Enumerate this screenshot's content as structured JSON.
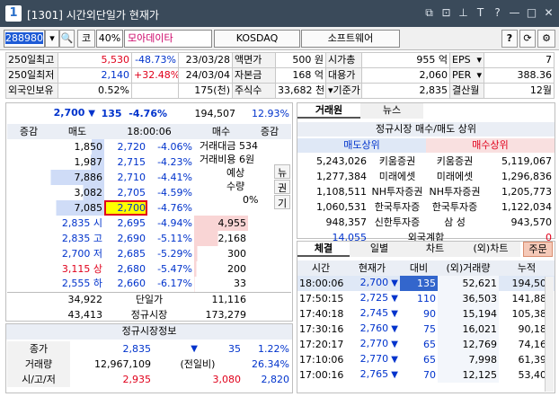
{
  "window": {
    "badge": "1",
    "code_label": "[1301]",
    "title": "시간외단일가 현재가",
    "icons": [
      "restore-icon",
      "copy-window-icon",
      "pin-icon",
      "font-size-icon",
      "help-icon",
      "minimize-icon",
      "maximize-icon",
      "close-icon"
    ]
  },
  "toolbar": {
    "stock_code": "288980",
    "code_btn": "코",
    "margin": "40%",
    "stock_name": "모아데이타",
    "market": "KOSDAQ",
    "sector": "소프트웨어",
    "help": "?",
    "refresh": "⟳",
    "settings": "⚙"
  },
  "info": [
    [
      "250일최고",
      "5,530",
      "-48.73%",
      "23/03/28",
      "액면가",
      "500 원",
      "시가총",
      "955 억",
      "EPS",
      "7"
    ],
    [
      "250일최저",
      "2,140",
      "+32.48%",
      "24/03/04",
      "자본금",
      "168 억",
      "대용가",
      "2,060",
      "PER",
      "388.36"
    ],
    [
      "외국인보유",
      "0.52%",
      "",
      "175(천)",
      "주식수",
      "33,682 천",
      "기준가",
      "2,835",
      "결산월",
      "12월"
    ]
  ],
  "quote": {
    "price": "2,700",
    "change": "135",
    "rate": "-4.76%",
    "volume": "194,507",
    "turn": "12.93%"
  },
  "ob_head": [
    "증감",
    "매도",
    "18:00:06",
    "매수",
    "증감"
  ],
  "asks": [
    [
      "",
      "1,850",
      "2,720",
      "-4.06%"
    ],
    [
      "",
      "1,987",
      "2,715",
      "-4.23%"
    ],
    [
      "",
      "7,886",
      "2,710",
      "-4.41%"
    ],
    [
      "",
      "3,082",
      "2,705",
      "-4.59%"
    ],
    [
      "",
      "7,085",
      "2,700",
      "-4.76%"
    ]
  ],
  "ask_bars": [
    0.23,
    0.25,
    0.99,
    0.39,
    0.89
  ],
  "ob_side": {
    "amt_label": "거래대금",
    "amt": "534",
    "vol_label": "거래비용",
    "vol": "6원",
    "exp_label": "예상",
    "qty_label": "수량",
    "pct": "0%",
    "btns": [
      "뉴",
      "권",
      "기"
    ]
  },
  "bids": [
    [
      "2,835",
      "시",
      "2,695",
      "-4.94%",
      "4,955"
    ],
    [
      "2,835",
      "고",
      "2,690",
      "-5.11%",
      "2,168"
    ],
    [
      "2,700",
      "저",
      "2,685",
      "-5.29%",
      "300"
    ],
    [
      "3,115",
      "상",
      "2,680",
      "-5.47%",
      "200"
    ],
    [
      "2,555",
      "하",
      "2,660",
      "-6.17%",
      "33"
    ]
  ],
  "bid_bars": [
    1.0,
    0.44,
    0.06,
    0.04,
    0.01
  ],
  "ob_foot": [
    [
      "34,922",
      "단일가",
      "11,116"
    ],
    [
      "43,413",
      "정규시장",
      "173,279"
    ],
    [
      "",
      "시간외",
      "34,871"
    ]
  ],
  "regular": {
    "title": "정규시장정보",
    "rows": [
      [
        "종가",
        "2,835",
        "▼",
        "35",
        "1.22%"
      ],
      [
        "거래량",
        "12,967,109",
        "(전일비)",
        "",
        "26.34%"
      ],
      [
        "시/고/저",
        "2,935",
        "3,080",
        "",
        "2,820"
      ]
    ]
  },
  "broker": {
    "tabs": [
      "거래원",
      "뉴스"
    ],
    "title": "정규시장 매수/매도 상위",
    "sell_head": "매도상위",
    "buy_head": "매수상위",
    "rows": [
      [
        "5,243,026",
        "키움증권",
        "키움증권",
        "5,119,067"
      ],
      [
        "1,277,384",
        "미래에셋",
        "미래에셋",
        "1,296,836"
      ],
      [
        "1,108,511",
        "NH투자증권",
        "NH투자증권",
        "1,205,773"
      ],
      [
        "1,060,531",
        "한국투자증",
        "한국투자증",
        "1,122,034"
      ],
      [
        "948,357",
        "신한투자증",
        "삼 성",
        "943,570"
      ]
    ],
    "foreign": [
      "14,055",
      "외국계합",
      "0"
    ]
  },
  "trade": {
    "tabs": [
      "체결",
      "일별",
      "차트",
      "(외)차트",
      "주문"
    ],
    "head": [
      "시간",
      "현재가",
      "대비",
      "(외)거래량",
      "누적"
    ],
    "rows": [
      [
        "18:00:06",
        "2,700",
        "135",
        "52,621",
        "194,507"
      ],
      [
        "17:50:15",
        "2,725",
        "110",
        "36,503",
        "141,886"
      ],
      [
        "17:40:18",
        "2,745",
        "90",
        "15,194",
        "105,383"
      ],
      [
        "17:30:16",
        "2,760",
        "75",
        "16,021",
        "90,189"
      ],
      [
        "17:20:17",
        "2,770",
        "65",
        "12,769",
        "74,168"
      ],
      [
        "17:10:06",
        "2,770",
        "65",
        "7,998",
        "61,399"
      ],
      [
        "17:00:16",
        "2,765",
        "70",
        "12,125",
        "53,401"
      ]
    ]
  },
  "colors": {
    "up": "#e0001b",
    "down": "#0033cc",
    "ask_bar": "#cfdcf7",
    "bid_bar": "#f9d5d5",
    "current": "#ffff00"
  }
}
